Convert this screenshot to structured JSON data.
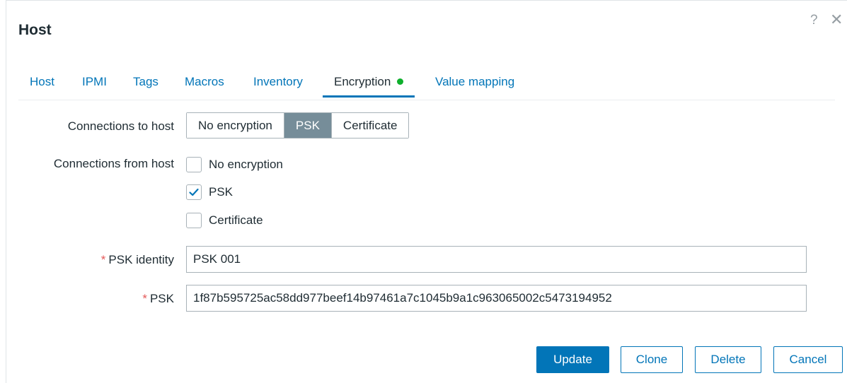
{
  "dialog": {
    "title": "Host",
    "help_glyph": "?",
    "close_glyph": "✕"
  },
  "tabs": [
    {
      "label": "Host"
    },
    {
      "label": "IPMI"
    },
    {
      "label": "Tags"
    },
    {
      "label": "Macros"
    },
    {
      "label": "Inventory"
    },
    {
      "label": "Encryption",
      "active": true
    },
    {
      "label": "Value mapping"
    }
  ],
  "connections_to_host": {
    "label": "Connections to host",
    "options": [
      "No encryption",
      "PSK",
      "Certificate"
    ],
    "selected": "PSK"
  },
  "connections_from_host": {
    "label": "Connections from host",
    "options": [
      {
        "label": "No encryption",
        "checked": false
      },
      {
        "label": "PSK",
        "checked": true
      },
      {
        "label": "Certificate",
        "checked": false
      }
    ]
  },
  "psk_identity": {
    "required_mark": "*",
    "label": "PSK identity",
    "value": "PSK 001"
  },
  "psk": {
    "required_mark": "*",
    "label": "PSK",
    "value": "1f87b595725ac58dd977beef14b97461a7c1045b9a1c963065002c5473194952"
  },
  "footer": {
    "update_label": "Update",
    "clone_label": "Clone",
    "delete_label": "Delete",
    "cancel_label": "Cancel"
  },
  "colors": {
    "accent": "#0275b8",
    "status_dot": "#0eaf2c",
    "segment_selected": "#768d99",
    "required": "#e45959"
  },
  "icons": {
    "help": "help-icon",
    "close": "close-icon",
    "checkmark": "checkmark-icon",
    "status": "status-dot-icon"
  }
}
